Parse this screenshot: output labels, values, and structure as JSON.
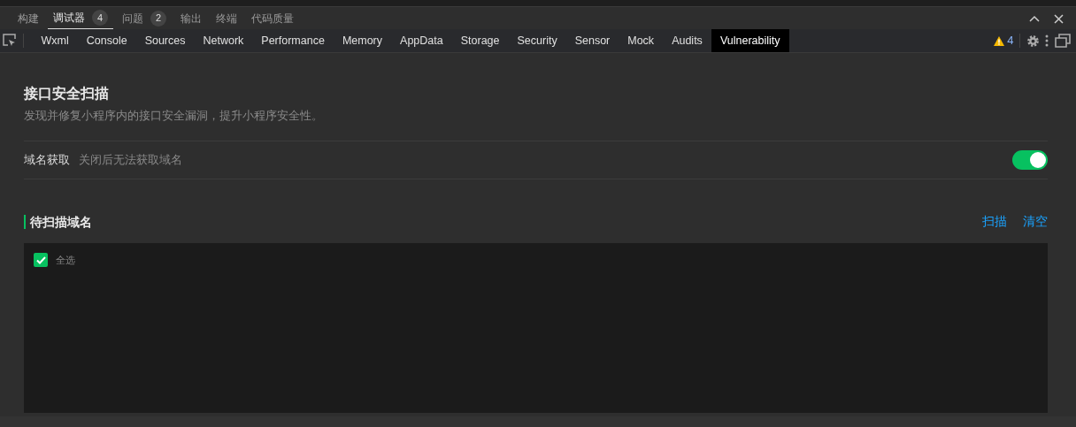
{
  "panel_tabs": [
    {
      "label": "构建",
      "selected": false
    },
    {
      "label": "调试器",
      "badge": "4",
      "selected": true
    },
    {
      "label": "问题",
      "badge": "2",
      "selected": false
    },
    {
      "label": "输出",
      "selected": false
    },
    {
      "label": "终端",
      "selected": false
    },
    {
      "label": "代码质量",
      "selected": false
    }
  ],
  "devtools_tabs": [
    {
      "label": "Wxml",
      "selected": false
    },
    {
      "label": "Console",
      "selected": false
    },
    {
      "label": "Sources",
      "selected": false
    },
    {
      "label": "Network",
      "selected": false
    },
    {
      "label": "Performance",
      "selected": false
    },
    {
      "label": "Memory",
      "selected": false
    },
    {
      "label": "AppData",
      "selected": false
    },
    {
      "label": "Storage",
      "selected": false
    },
    {
      "label": "Security",
      "selected": false
    },
    {
      "label": "Sensor",
      "selected": false
    },
    {
      "label": "Mock",
      "selected": false
    },
    {
      "label": "Audits",
      "selected": false
    },
    {
      "label": "Vulnerability",
      "selected": true
    }
  ],
  "warning_count": "4",
  "scan": {
    "title": "接口安全扫描",
    "description": "发现并修复小程序内的接口安全漏洞，提升小程序安全性。",
    "setting": {
      "label": "域名获取",
      "hint": "关闭后无法获取域名",
      "on": true
    },
    "section_title": "待扫描域名",
    "actions": [
      "扫描",
      "清空"
    ],
    "select_all": {
      "label": "全选",
      "checked": true
    }
  }
}
